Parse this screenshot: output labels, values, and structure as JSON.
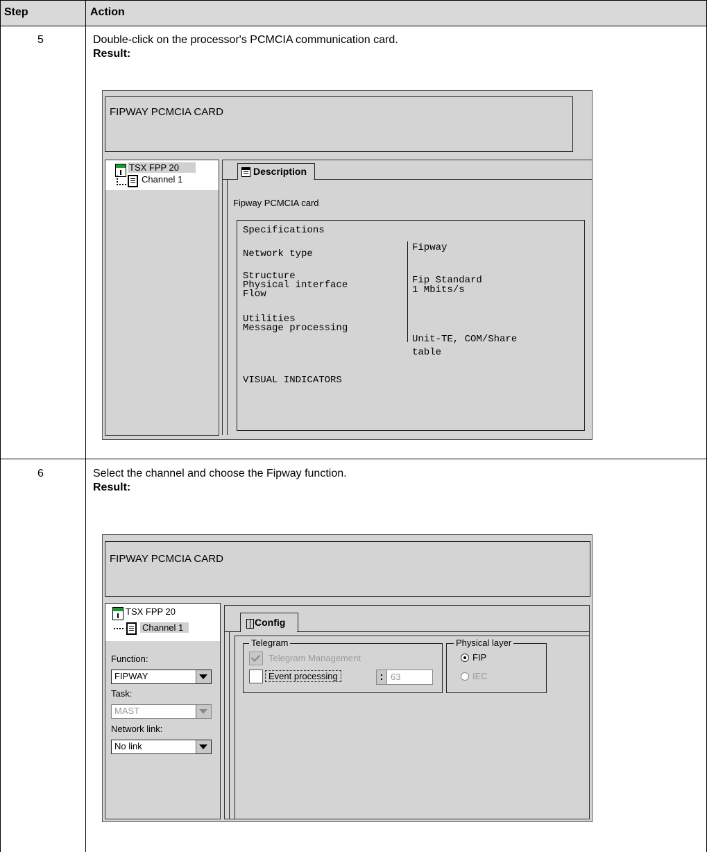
{
  "table": {
    "headers": {
      "step": "Step",
      "action": "Action"
    },
    "rows": [
      {
        "step": "5",
        "instruction": "Double-click on the processor's PCMCIA communication card.",
        "result_label": "Result:"
      },
      {
        "step": "6",
        "instruction": "Select the channel and choose the Fipway function.",
        "result_label": "Result:"
      }
    ]
  },
  "screen1": {
    "title": "FIPWAY PCMCIA CARD",
    "tree": {
      "module": "TSX FPP 20",
      "channel": "Channel 1"
    },
    "tab": "Description",
    "card_desc": "Fipway PCMCIA card",
    "spec": {
      "heading": "Specifications",
      "left": [
        "Network type",
        "Structure",
        "Physical interface",
        "Flow",
        "Utilities",
        "Message processing",
        "VISUAL INDICATORS"
      ],
      "right": [
        "Fipway",
        "Fip Standard",
        "1 Mbits/s",
        "Unit-TE, COM/Share",
        "table"
      ]
    }
  },
  "screen2": {
    "title": "FIPWAY PCMCIA CARD",
    "tree": {
      "module": "TSX FPP 20",
      "channel": "Channel 1"
    },
    "function_label": "Function:",
    "function_value": "FIPWAY",
    "task_label": "Task:",
    "task_value": "MAST",
    "network_label": "Network link:",
    "network_value": "No link",
    "tab": "Config",
    "telegram": {
      "legend": "Telegram",
      "management": "Telegram Management",
      "event": "Event processing",
      "value": "63"
    },
    "physical": {
      "legend": "Physical layer",
      "fip": "FIP",
      "iec": "IEC"
    }
  }
}
